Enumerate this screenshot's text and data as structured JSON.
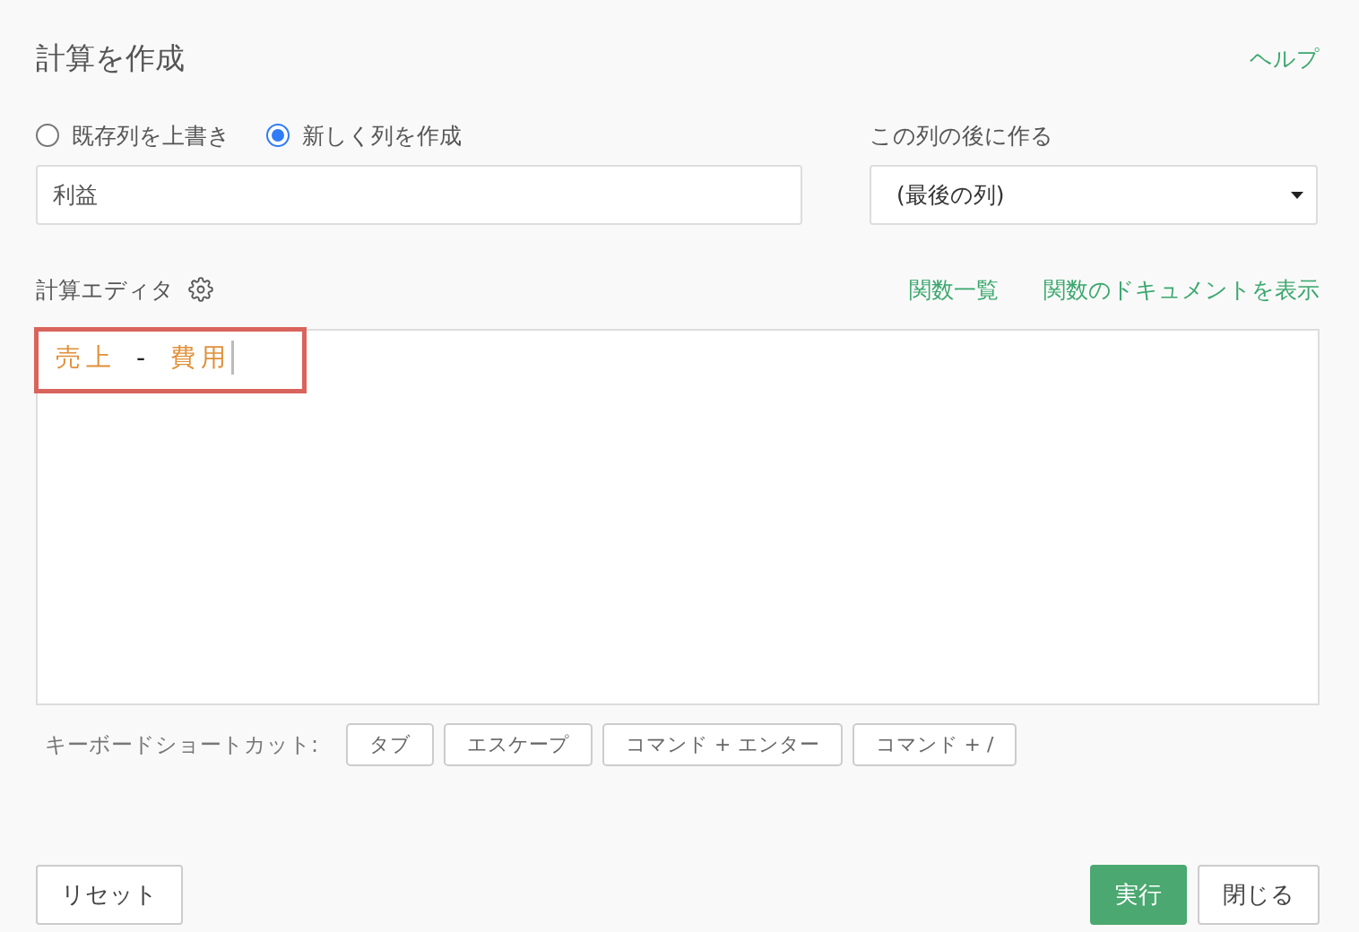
{
  "title": "計算を作成",
  "help_link": "ヘルプ",
  "modes": [
    {
      "label": "既存列を上書き",
      "selected": false
    },
    {
      "label": "新しく列を作成",
      "selected": true
    }
  ],
  "column_name": {
    "value": "利益"
  },
  "position": {
    "label": "この列の後に作る",
    "value": "(最後の列)"
  },
  "editor": {
    "label": "計算エディタ",
    "links": [
      "関数一覧",
      "関数のドキュメントを表示"
    ],
    "tokens": [
      {
        "kind": "column",
        "text": "売上"
      },
      {
        "kind": "operator",
        "text": "-"
      },
      {
        "kind": "column",
        "text": "費用"
      }
    ]
  },
  "shortcuts": {
    "label": "キーボードショートカット:",
    "keys": [
      "タブ",
      "エスケープ",
      "コマンド + エンター",
      "コマンド + /"
    ]
  },
  "buttons": {
    "reset": "リセット",
    "run": "実行",
    "close": "閉じる"
  }
}
